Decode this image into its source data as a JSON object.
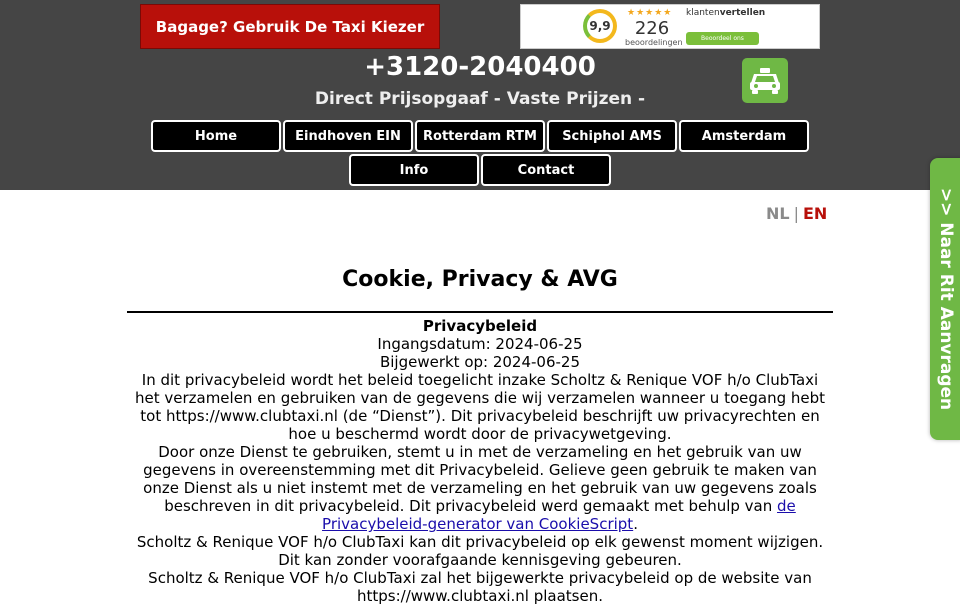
{
  "header": {
    "promo_label": "Bagage? Gebruik De Taxi Kiezer",
    "phone": "+3120-2040400",
    "tagline": "Direct Prijsopgaaf - Vaste Prijzen -",
    "rating_widget": {
      "score": "9,9",
      "count": "226",
      "count_label": "beoordelingen",
      "brand_light": "klanten",
      "brand_bold": "vertellen",
      "button_label": "Beoordeel ons",
      "stars": "★★★★★"
    }
  },
  "nav": {
    "items": [
      "Home",
      "Eindhoven EIN",
      "Rotterdam RTM",
      "Schiphol AMS",
      "Amsterdam",
      "Info",
      "Contact"
    ]
  },
  "side_tab": {
    "label": ">> Naar Rit Aanvragen"
  },
  "lang": {
    "nl": "NL",
    "sep": "|",
    "en": "EN"
  },
  "page": {
    "title": "Cookie, Privacy & AVG",
    "heading": "Privacybeleid",
    "effective": "Ingangsdatum: 2024-06-25",
    "updated": "Bijgewerkt op: 2024-06-25",
    "p1": "In dit privacybeleid wordt het beleid toegelicht inzake Scholtz & Renique VOF h/o ClubTaxi het verzamelen en gebruiken van de gegevens die wij verzamelen wanneer u toegang hebt tot https://www.clubtaxi.nl (de “Dienst”). Dit privacybeleid beschrijft uw privacyrechten en hoe u beschermd wordt door de privacywetgeving.",
    "p2_text": "Door onze Dienst te gebruiken, stemt u in met de verzameling en het gebruik van uw gegevens in overeenstemming met dit Privacybeleid. Gelieve geen gebruik te maken van onze Dienst als u niet instemt met de verzameling en het gebruik van uw gegevens zoals beschreven in dit privacybeleid. Dit privacybeleid werd gemaakt met behulp van ",
    "p2_link": "de Privacybeleid-generator van CookieScript",
    "p2_end": ".",
    "p3": "Scholtz & Renique VOF h/o ClubTaxi kan dit privacybeleid op elk gewenst moment wijzigen. Dit kan zonder voorafgaande kennisgeving gebeuren.",
    "p4": "Scholtz & Renique VOF h/o ClubTaxi zal het bijgewerkte privacybeleid op de website van https://www.clubtaxi.nl plaatsen."
  },
  "colors": {
    "header_bg": "#454545",
    "promo_bg": "#b8100a",
    "accent_green": "#6fb845",
    "lang_active": "#b8100a"
  }
}
